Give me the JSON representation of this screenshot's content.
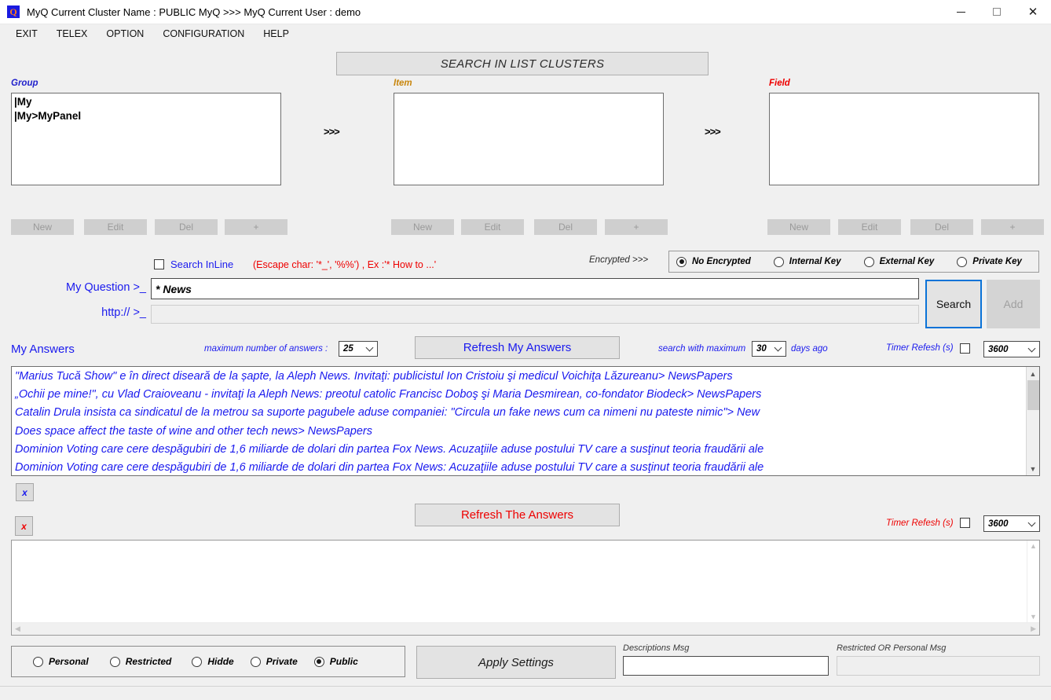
{
  "window": {
    "title": "MyQ Current Cluster Name : PUBLIC MyQ >>> MyQ Current User : demo",
    "icon_letter": "Q",
    "minimize_label": "minimize",
    "maximize_label": "maximize",
    "close_label": "close"
  },
  "menubar": {
    "items": [
      {
        "label": "EXIT"
      },
      {
        "label": "TELEX"
      },
      {
        "label": "OPTION"
      },
      {
        "label": "CONFIGURATION"
      },
      {
        "label": "HELP"
      }
    ]
  },
  "search_header": {
    "title": "SEARCH IN LIST CLUSTERS"
  },
  "columns": {
    "group": {
      "label": "Group",
      "label_color": "#2222cc",
      "items": [
        "|My",
        "|My>MyPanel"
      ],
      "buttons": [
        "New",
        "Edit",
        "Del",
        "+"
      ]
    },
    "item": {
      "label": "Item",
      "label_color": "#c8860d",
      "items": [],
      "buttons": [
        "New",
        "Edit",
        "Del",
        "+"
      ]
    },
    "field": {
      "label": "Field",
      "label_color": "#ee0000",
      "items": [],
      "buttons": [
        "New",
        "Edit",
        "Del",
        "+"
      ]
    },
    "arrow_1": ">>>",
    "arrow_2": ">>>"
  },
  "search_options": {
    "inline_label": "Search InLine",
    "inline_checked": false,
    "escape_hint": "(Escape char: '*_', '%%') , Ex :'* How to ...'",
    "encrypted_label": "Encrypted >>>",
    "encryption_modes": [
      {
        "label": "No Encrypted",
        "selected": true
      },
      {
        "label": "Internal Key",
        "selected": false
      },
      {
        "label": "External Key",
        "selected": false
      },
      {
        "label": "Private Key",
        "selected": false
      }
    ]
  },
  "question": {
    "label": "My Question >_",
    "value": "* News",
    "url_label": "http:// >_",
    "url_value": "",
    "search_button": "Search",
    "add_button": "Add"
  },
  "answers_bar": {
    "title": "My Answers",
    "max_answers_label": "maximum number of answers :",
    "max_answers_value": "25",
    "refresh_button": "Refresh My Answers",
    "days_prefix": "search with maximum",
    "days_value": "30",
    "days_suffix": "days ago",
    "timer_label": "Timer Refesh (s)",
    "timer_checked": false,
    "timer_value": "3600"
  },
  "answers": {
    "lines": [
      "\"Marius Tucă Show\" e în direct diseară de la șapte, la Aleph News. Invitaţi: publicistul Ion Cristoiu şi medicul Voichiţa Lăzureanu> NewsPapers",
      "„Ochii pe mine!\", cu Vlad Craioveanu - invitaţi la Aleph News: preotul catolic Francisc Doboş şi Maria Desmirean, co-fondator Biodeck> NewsPapers",
      "Catalin Drula insista ca sindicatul de la metrou sa suporte pagubele aduse companiei: \"Circula un fake news cum ca nimeni nu pateste nimic\"> New",
      "Does space affect the taste of wine and other tech news> NewsPapers",
      "Dominion Voting care cere despăgubiri de 1,6 miliarde de dolari din partea Fox News. Acuzaţiile aduse postului TV care a susţinut teoria fraudării ale",
      "Dominion Voting care cere despăgubiri de 1,6 miliarde de dolari din partea Fox News: Acuzaţiile aduse postului TV care a susţinut teoria fraudării ale"
    ],
    "text_color": "#1a1aee"
  },
  "lower_bar": {
    "clear_answers_button": "x",
    "clear_the_answers_button": "x",
    "refresh_button": "Refresh The Answers",
    "refresh_color": "#ee0000",
    "timer_label": "Timer Refesh (s)",
    "timer_checked": false,
    "timer_value": "3600"
  },
  "lower_box": {
    "value": ""
  },
  "bottom": {
    "permissions": [
      {
        "label": "Personal",
        "selected": false
      },
      {
        "label": "Restricted",
        "selected": false
      },
      {
        "label": "Hidde",
        "selected": false
      },
      {
        "label": "Private",
        "selected": false
      },
      {
        "label": "Public",
        "selected": true
      }
    ],
    "apply_button": "Apply Settings",
    "descriptions_label": "Descriptions Msg",
    "descriptions_value": "",
    "restricted_label": "Restricted OR Personal Msg",
    "restricted_value": ""
  }
}
